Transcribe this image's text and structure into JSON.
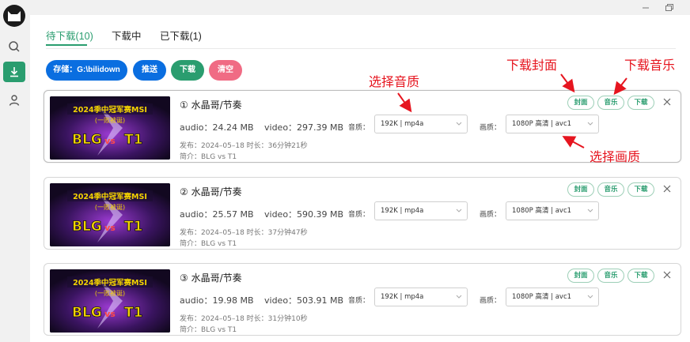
{
  "theme": {
    "accent": "#2a9d6f",
    "primary_blue": "#0a6ee0",
    "danger_pink": "#f06b84",
    "annotation_red": "#e6151f"
  },
  "sidebar": {
    "items": [
      {
        "icon": "search-icon"
      },
      {
        "icon": "download-icon",
        "active": true
      },
      {
        "icon": "user-icon"
      }
    ]
  },
  "tabs": [
    {
      "label": "待下载(10)",
      "active": true
    },
    {
      "label": "下载中"
    },
    {
      "label": "已下载(1)"
    }
  ],
  "toolbar": {
    "storage_label": "存储：G:\\bilidown",
    "push_label": "推送",
    "download_label": "下载",
    "clear_label": "清空"
  },
  "cards": [
    {
      "title": "① 水晶哥/节奏",
      "audio_label": "audio：24.24 MB",
      "video_label": "video：297.39 MB",
      "publish": "发布：2024–05–18 时长：36分钟21秒",
      "intro": "简介：BLG vs T1",
      "audio_quality_label": "音质：",
      "audio_quality_value": "192K | mp4a",
      "video_quality_label": "画质：",
      "video_quality_value": "1080P 高清 | avc1",
      "cover_btn": "封面",
      "music_btn": "音乐",
      "download_btn": "下载",
      "thumb_banner": "2024季中冠军赛MSI",
      "thumb_sub": "(一败被诞)",
      "thumb_left": "BLG",
      "thumb_vs": "vs",
      "thumb_right": "T1"
    },
    {
      "title": "② 水晶哥/节奏",
      "audio_label": "audio：25.57 MB",
      "video_label": "video：590.39 MB",
      "publish": "发布：2024–05–18 时长：37分钟47秒",
      "intro": "简介：BLG vs T1",
      "audio_quality_label": "音质：",
      "audio_quality_value": "192K | mp4a",
      "video_quality_label": "画质：",
      "video_quality_value": "1080P 高清 | avc1",
      "cover_btn": "封面",
      "music_btn": "音乐",
      "download_btn": "下载",
      "thumb_banner": "2024季中冠军赛MSI",
      "thumb_sub": "(一败被诞)",
      "thumb_left": "BLG",
      "thumb_vs": "vs",
      "thumb_right": "T1"
    },
    {
      "title": "③ 水晶哥/节奏",
      "audio_label": "audio：19.98 MB",
      "video_label": "video：503.91 MB",
      "publish": "发布：2024–05–18 时长：31分钟10秒",
      "intro": "简介：BLG vs T1",
      "audio_quality_label": "音质：",
      "audio_quality_value": "192K | mp4a",
      "video_quality_label": "画质：",
      "video_quality_value": "1080P 高清 | avc1",
      "cover_btn": "封面",
      "music_btn": "音乐",
      "download_btn": "下载",
      "thumb_banner": "2024季中冠军赛MSI",
      "thumb_sub": "(一败被诞)",
      "thumb_left": "BLG",
      "thumb_vs": "vs",
      "thumb_right": "T1"
    }
  ],
  "annotations": {
    "select_audio": "选择音质",
    "download_cover": "下载封面",
    "download_music": "下载音乐",
    "select_video": "选择画质"
  }
}
